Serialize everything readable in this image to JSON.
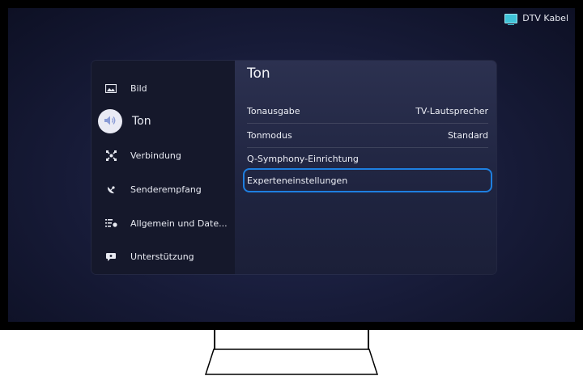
{
  "source": {
    "label": "DTV Kabel",
    "icon": "tv-source-icon"
  },
  "sidebar": {
    "items": [
      {
        "label": "Bild",
        "icon": "picture-icon",
        "active": false
      },
      {
        "label": "Ton",
        "icon": "speaker-icon",
        "active": true
      },
      {
        "label": "Verbindung",
        "icon": "connection-icon",
        "active": false
      },
      {
        "label": "Senderempfang",
        "icon": "satellite-dish-icon",
        "active": false
      },
      {
        "label": "Allgemein und Date...",
        "icon": "general-settings-icon",
        "active": false
      },
      {
        "label": "Unterstützung",
        "icon": "support-icon",
        "active": false
      }
    ]
  },
  "content": {
    "title": "Ton",
    "rows": [
      {
        "label": "Tonausgabe",
        "value": "TV-Lautsprecher"
      },
      {
        "label": "Tonmodus",
        "value": "Standard"
      },
      {
        "label": "Q-Symphony-Einrichtung",
        "value": ""
      },
      {
        "label": "Experteneinstellungen",
        "value": "",
        "focused": true
      }
    ]
  },
  "colors": {
    "focus": "#1e7fe0",
    "accent_source": "#3fc3d8"
  }
}
